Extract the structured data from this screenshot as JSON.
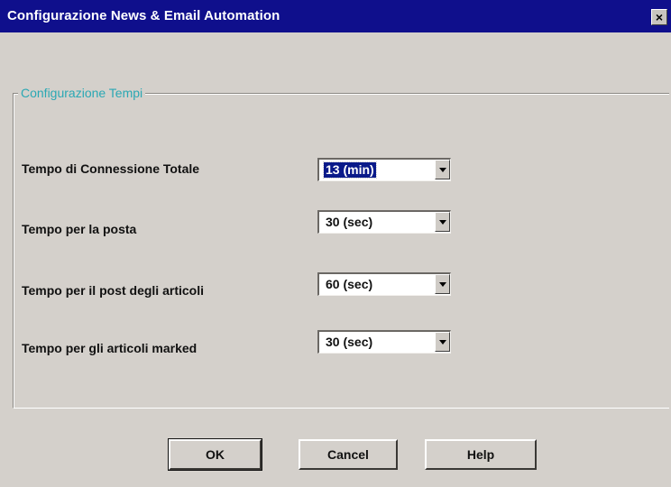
{
  "window": {
    "title": "Configurazione News & Email Automation",
    "close_glyph": "×"
  },
  "group": {
    "legend": "Configurazione Tempi"
  },
  "fields": [
    {
      "label": "Tempo di Connessione Totale",
      "value": "13 (min)",
      "selected": true
    },
    {
      "label": "Tempo per la posta",
      "value": "30  (sec)",
      "selected": false
    },
    {
      "label": "Tempo per il post degli articoli",
      "value": "60  (sec)",
      "selected": false
    },
    {
      "label": "Tempo per gli articoli marked",
      "value": "30  (sec)",
      "selected": false
    }
  ],
  "buttons": {
    "ok": "OK",
    "cancel": "Cancel",
    "help": "Help"
  },
  "colors": {
    "titlebar": "#0f0f8c",
    "legend_text": "#2aa8b4",
    "selection": "#0a1a8a"
  },
  "icons": {
    "close": "close-icon",
    "dropdown": "chevron-down-icon"
  }
}
